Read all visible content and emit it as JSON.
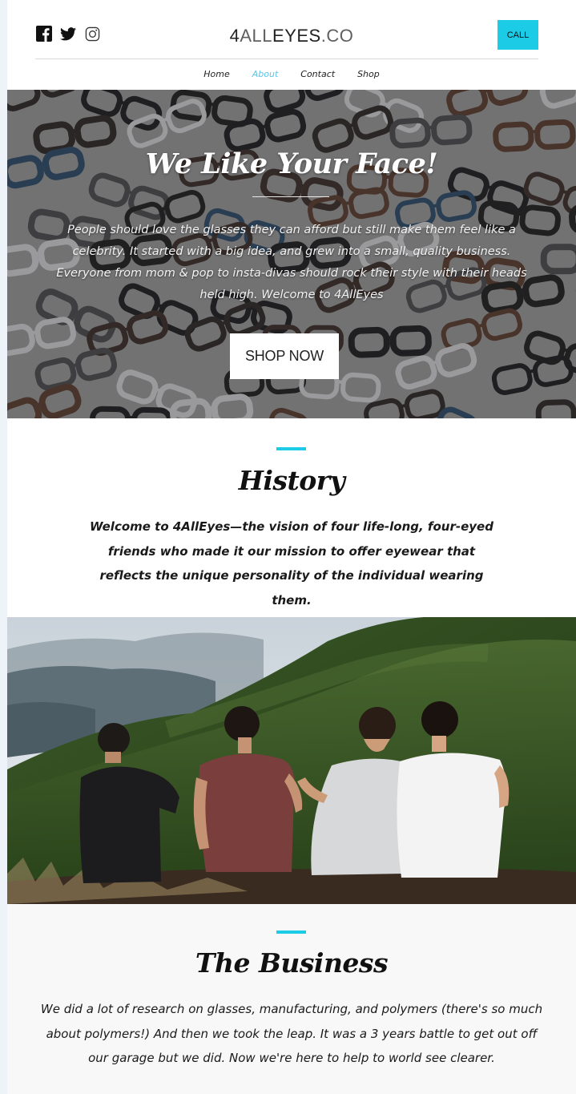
{
  "header": {
    "brand_prefix": "4",
    "brand_middle": "ALL",
    "brand_main": "EYES",
    "brand_suffix": ".CO",
    "call_label": "CALL",
    "social_icons": [
      "facebook-icon",
      "twitter-icon",
      "instagram-icon"
    ]
  },
  "nav": {
    "items": [
      {
        "label": "Home",
        "active": false
      },
      {
        "label": "About",
        "active": true
      },
      {
        "label": "Contact",
        "active": false
      },
      {
        "label": "Shop",
        "active": false
      }
    ]
  },
  "hero": {
    "title": "We Like Your Face!",
    "text": "People should love the glasses they can afford but still make them feel like a celebrity. It started with a big idea, and grew into a small, quality business. Everyone from mom & pop to insta-divas should rock their style with their heads held high. Welcome to 4AllEyes",
    "button_label": "SHOP NOW"
  },
  "history": {
    "title": "History",
    "text": "Welcome to 4AllEyes—the vision of four life-long, four-eyed friends who made it our mission to offer eyewear that reflects the unique personality of the individual wearing them."
  },
  "business": {
    "title": "The Business",
    "text": "We did a lot of research on glasses, manufacturing, and polymers (there's so much about polymers!) And then we took the leap. It was a 3 years battle to get out off our garage but we did. Now we're here to help to world see clearer."
  },
  "colors": {
    "accent": "#1ccbe6",
    "nav_active": "#5bc4e6"
  }
}
